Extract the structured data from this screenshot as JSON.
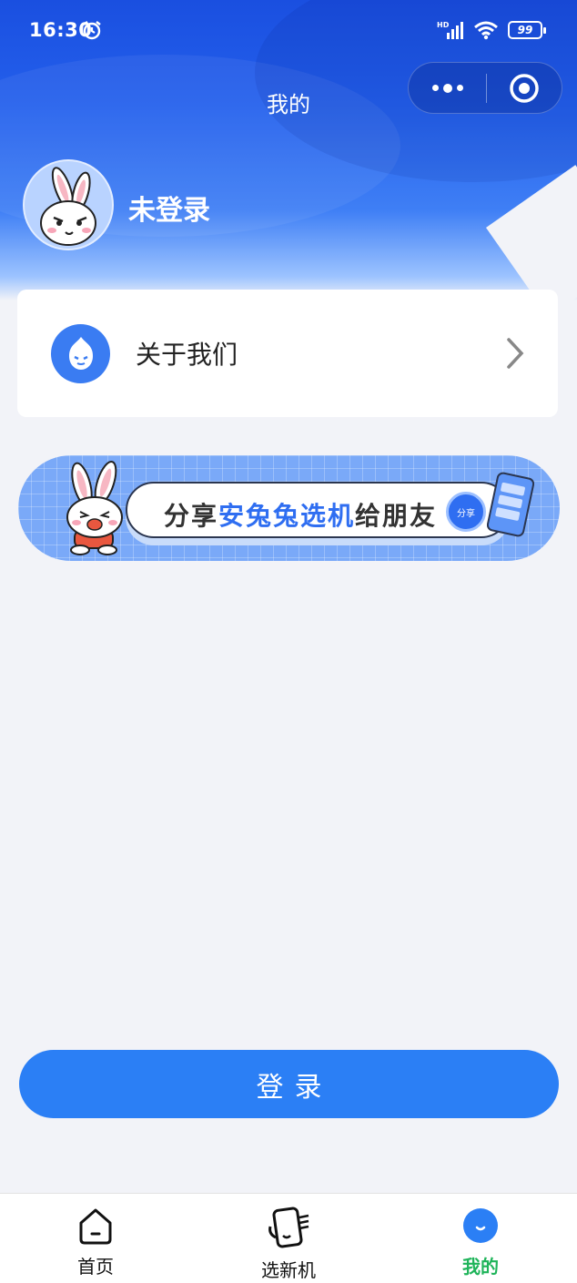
{
  "status_bar": {
    "time": "16:30",
    "network": "HD",
    "battery": "99"
  },
  "nav": {
    "title": "我的"
  },
  "user": {
    "name": "未登录"
  },
  "menu": {
    "items": [
      {
        "label": "关于我们"
      }
    ]
  },
  "share_banner": {
    "text_prefix": "分享",
    "text_highlight": "安兔兔选机",
    "text_suffix": "给朋友",
    "button_label": "分享"
  },
  "login": {
    "label": "登录"
  },
  "tab_bar": {
    "items": [
      {
        "label": "首页",
        "icon": "home-icon"
      },
      {
        "label": "选新机",
        "icon": "phone-select-icon"
      },
      {
        "label": "我的",
        "icon": "mine-icon"
      }
    ],
    "active_color": "#1fb45a"
  },
  "colors": {
    "primary": "#2b7ff5",
    "header": "#1a4fe0"
  }
}
